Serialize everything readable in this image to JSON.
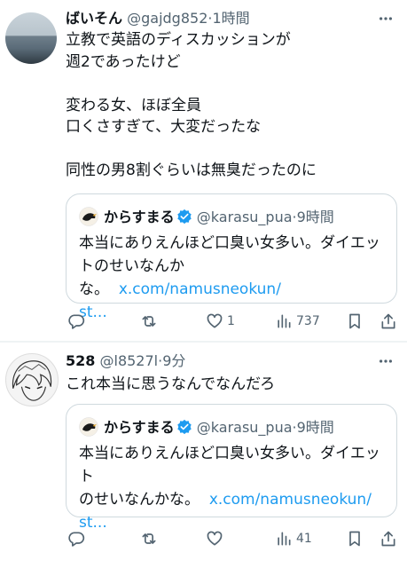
{
  "posts": [
    {
      "name": "ばいそん",
      "handle": "@gajdg852",
      "time": "·1時間",
      "text": "立教で英語のディスカッションが\n週2であったけど\n\n変わる女、ほぼ全員\n口くさすぎて、大変だったな\n\n同性の男8割ぐらいは無臭だったのに",
      "quote": {
        "name": "からすまる",
        "handle": "@karasu_pua",
        "time": "·9時間",
        "text_line1": "本当にありえんほど口臭い女多い。ダイエッ",
        "text_line2": "トのせいなんかな。",
        "link_part1": "x.com/namusneokun/",
        "link_part2": "st..."
      },
      "actions": {
        "replies": "",
        "reposts": "",
        "likes": "1",
        "views": "737"
      }
    },
    {
      "name": "528",
      "handle": "@l8527l",
      "time": "·9分",
      "text": "これ本当に思うなんでなんだろ",
      "quote": {
        "name": "からすまる",
        "handle": "@karasu_pua",
        "time": "·9時間",
        "text_line1": "本当にありえんほど口臭い女多い。ダイエット",
        "text_line2": "のせいなんかな。",
        "link_part1": "x.com/namusneokun/",
        "link_part2": "st..."
      },
      "actions": {
        "replies": "",
        "reposts": "",
        "likes": "",
        "views": "41"
      }
    }
  ],
  "colors": {
    "link": "#1d9bf0",
    "secondary": "#536471",
    "verified": "#1d9bf0",
    "border": "#cfd9de"
  }
}
